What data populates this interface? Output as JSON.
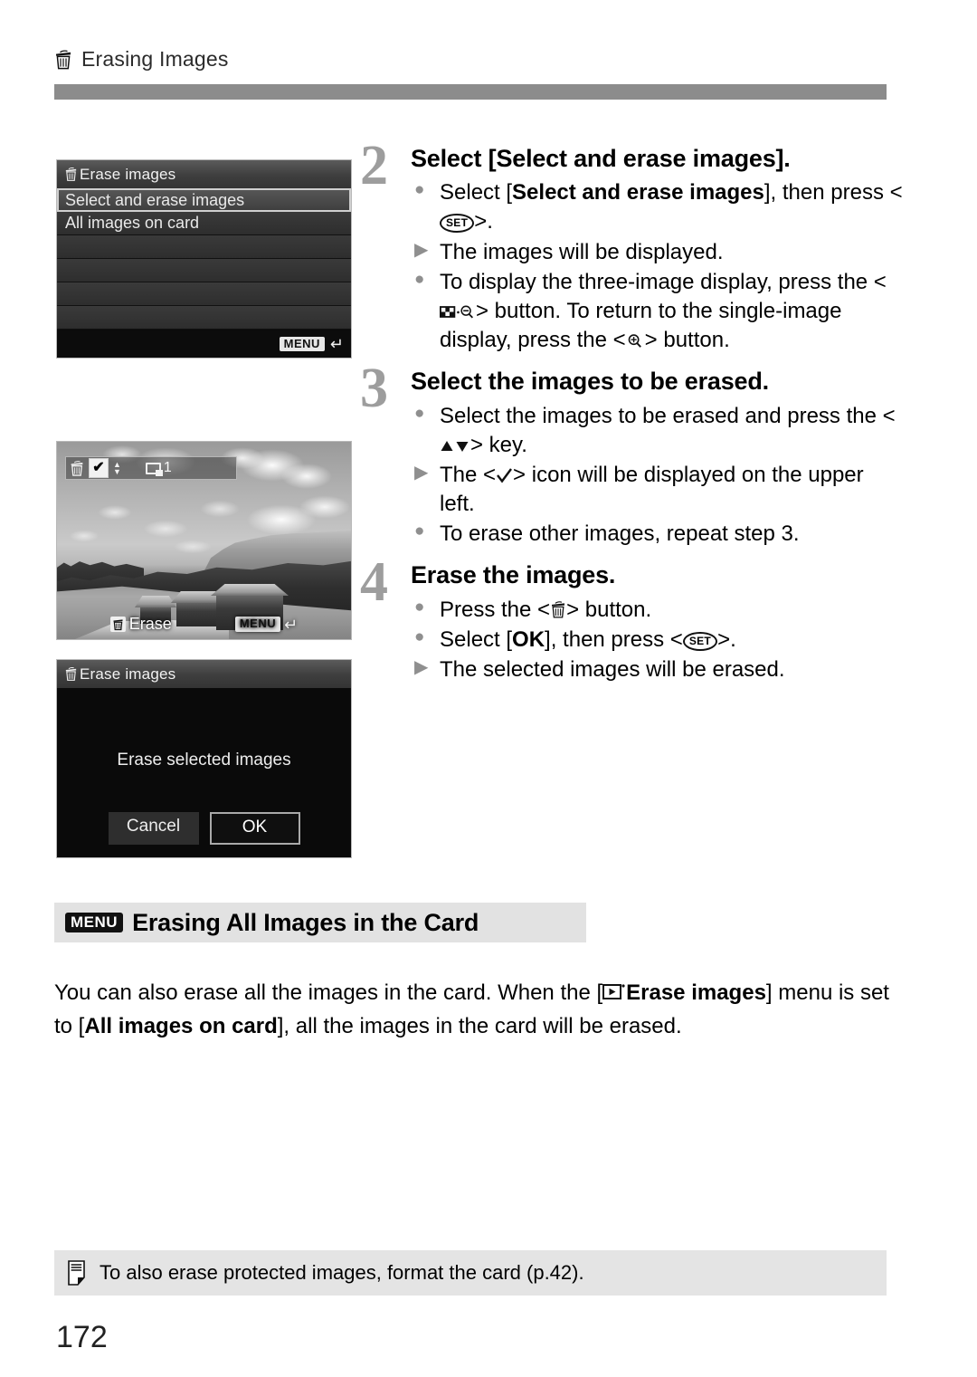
{
  "header": {
    "icon": "trash-icon",
    "title": "Erasing Images"
  },
  "figures": {
    "menu_screen": {
      "title_icon": "trash-icon",
      "title": "Erase images",
      "rows": [
        {
          "label": "Select and erase images",
          "selected": true
        },
        {
          "label": "All images on card",
          "selected": false
        },
        {
          "label": "",
          "selected": false
        },
        {
          "label": "",
          "selected": false
        },
        {
          "label": "",
          "selected": false
        },
        {
          "label": "",
          "selected": false
        }
      ],
      "footer_badge": "MENU",
      "footer_icon": "return-arrow-icon"
    },
    "photo_screen": {
      "overlay_trash_icon": "trash-icon",
      "checkmark": "✔",
      "updown_icon": "up-down-arrows-icon",
      "display_mode_icon": "single-image-display-icon",
      "display_mode_count": "1",
      "erase_label": "Erase",
      "erase_icon": "trash-icon",
      "footer_badge": "MENU",
      "footer_icon": "return-arrow-icon"
    },
    "confirm_screen": {
      "title_icon": "trash-icon",
      "title": "Erase images",
      "message": "Erase selected images",
      "cancel_label": "Cancel",
      "ok_label": "OK"
    }
  },
  "steps": [
    {
      "number": "2",
      "title": "Select [Select and erase images].",
      "bullets": [
        {
          "marker": "dot",
          "parts": [
            {
              "t": "Select ["
            },
            {
              "t": "Select and erase images",
              "bold": true
            },
            {
              "t": "], then press <"
            },
            {
              "icon": "set-button-icon",
              "t": "SET"
            },
            {
              "t": ">."
            }
          ]
        },
        {
          "marker": "triangle",
          "parts": [
            {
              "t": "The images will be displayed."
            }
          ]
        },
        {
          "marker": "dot",
          "parts": [
            {
              "t": "To display the three-image display, press the <"
            },
            {
              "icon": "index-zoom-out-button-icon"
            },
            {
              "t": "> button. To return to the single-image display, press the <"
            },
            {
              "icon": "magnify-zoom-in-button-icon"
            },
            {
              "t": "> button."
            }
          ]
        }
      ]
    },
    {
      "number": "3",
      "title": "Select the images to be erased.",
      "bullets": [
        {
          "marker": "dot",
          "parts": [
            {
              "t": "Select the images to be erased and press the <"
            },
            {
              "icon": "up-down-arrows-icon"
            },
            {
              "t": "> key."
            }
          ]
        },
        {
          "marker": "triangle",
          "parts": [
            {
              "t": "The <"
            },
            {
              "icon": "checkmark-icon"
            },
            {
              "t": "> icon will be displayed on the upper left."
            }
          ]
        },
        {
          "marker": "dot",
          "parts": [
            {
              "t": "To erase other images, repeat step 3."
            }
          ]
        }
      ]
    },
    {
      "number": "4",
      "title": "Erase the images.",
      "bullets": [
        {
          "marker": "dot",
          "parts": [
            {
              "t": "Press the <"
            },
            {
              "icon": "trash-icon"
            },
            {
              "t": "> button."
            }
          ]
        },
        {
          "marker": "dot",
          "parts": [
            {
              "t": "Select ["
            },
            {
              "t": "OK",
              "bold": true
            },
            {
              "t": "], then press <"
            },
            {
              "icon": "set-button-icon",
              "t": "SET"
            },
            {
              "t": ">."
            }
          ]
        },
        {
          "marker": "triangle",
          "parts": [
            {
              "t": "The selected images will be erased."
            }
          ]
        }
      ]
    }
  ],
  "section": {
    "badge": "MENU",
    "title": "Erasing All Images in the Card",
    "paragraph": {
      "lead": "You can also erase all the images in the card. When the [",
      "menu_icon": "playback-menu-icon",
      "menu_name": "Erase images",
      "mid": "] menu is set to [",
      "setting": "All images on card",
      "tail": "], all the images in the card will be erased."
    }
  },
  "note": {
    "icon": "note-icon",
    "text": "To also erase protected images, format the card (p.42)."
  },
  "page_number": "172",
  "colors": {
    "header_rule": "#8c8c8c",
    "step_number": "#9d9d9d",
    "section_band": "#e2e2e2",
    "note_band": "#e4e4e4",
    "marker_gray": "#8f8f8f"
  }
}
